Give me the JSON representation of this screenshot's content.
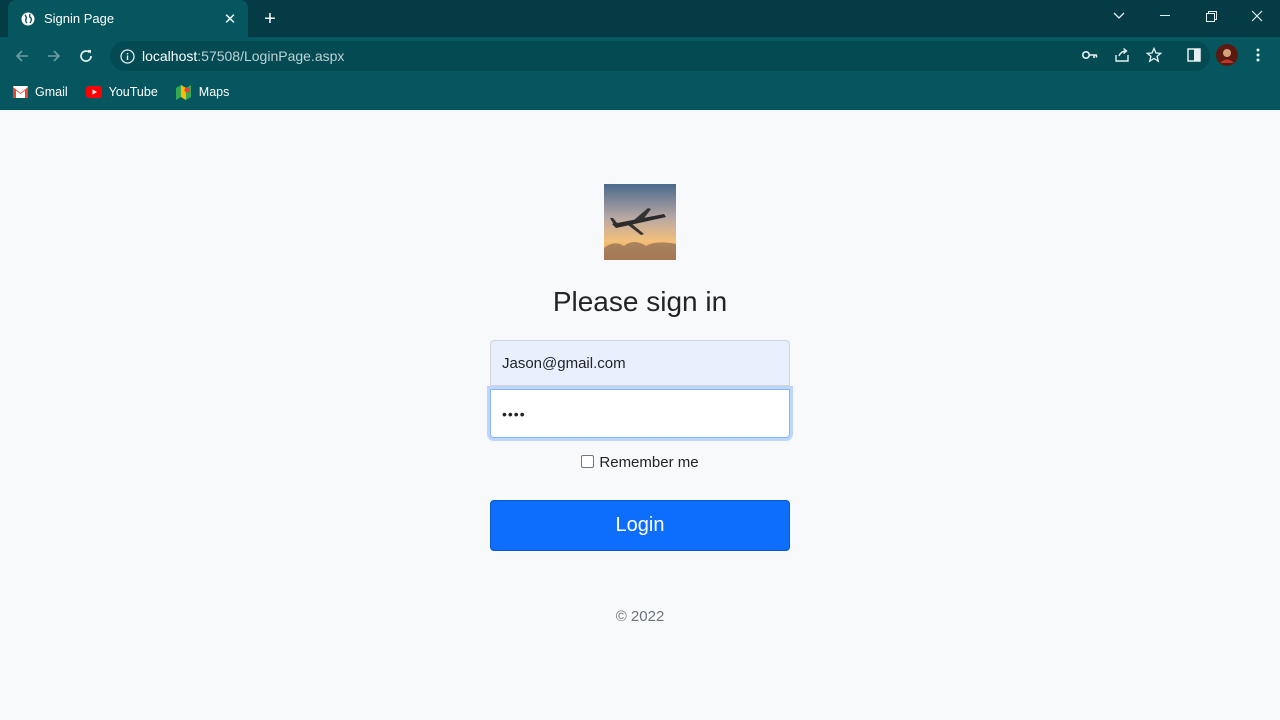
{
  "browser": {
    "tab_title": "Signin Page",
    "url_host": "localhost",
    "url_rest": ":57508/LoginPage.aspx",
    "bookmarks": [
      {
        "label": "Gmail"
      },
      {
        "label": "YouTube"
      },
      {
        "label": "Maps"
      }
    ]
  },
  "login": {
    "heading": "Please sign in",
    "email_value": "Jason@gmail.com",
    "password_value": "••••",
    "remember_label": "Remember me",
    "login_label": "Login",
    "footer": "© 2022"
  },
  "colors": {
    "chrome_dark": "#053b44",
    "chrome": "#06565f",
    "primary": "#0d6efd",
    "autofill": "#e8f0fe"
  }
}
